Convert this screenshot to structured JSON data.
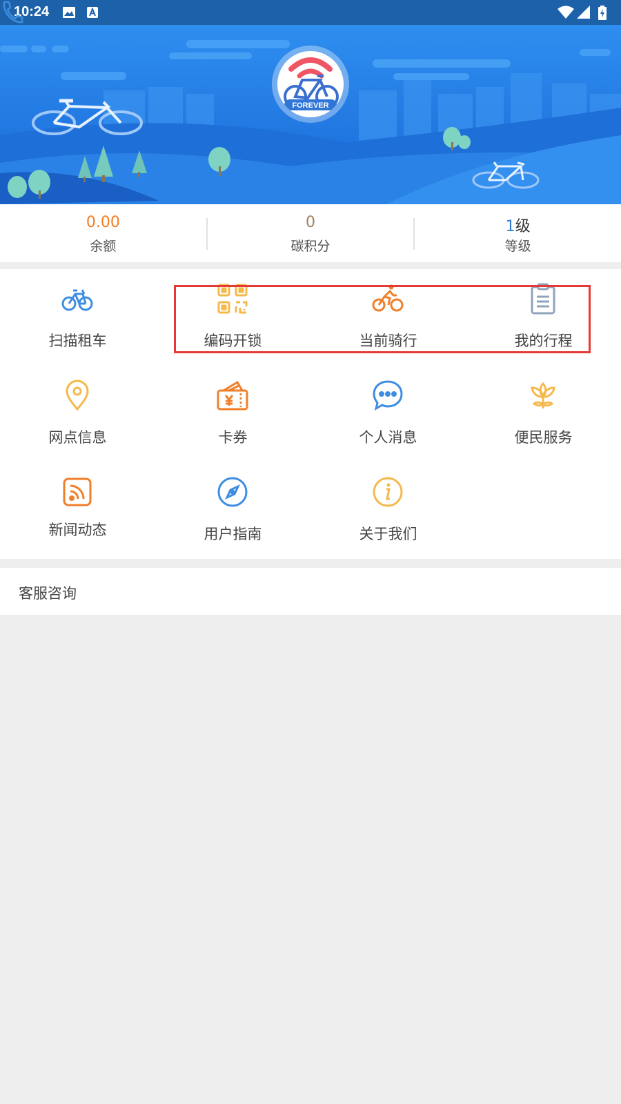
{
  "status_bar": {
    "time": "10:24"
  },
  "header": {
    "logo_text": "FOREVER"
  },
  "stats": [
    {
      "value": "0.00",
      "label": "余额",
      "color": "#f57c1f"
    },
    {
      "value": "0",
      "label": "碳积分",
      "color": "#a08060"
    },
    {
      "value": "1",
      "suffix": "级",
      "label": "等级",
      "color": "#2e7bd6"
    }
  ],
  "menu": {
    "items": [
      {
        "label": "扫描租车",
        "icon": "bike-icon"
      },
      {
        "label": "编码开锁",
        "icon": "qrcode-icon"
      },
      {
        "label": "当前骑行",
        "icon": "cyclist-icon"
      },
      {
        "label": "我的行程",
        "icon": "clipboard-icon"
      },
      {
        "label": "网点信息",
        "icon": "location-pin-icon"
      },
      {
        "label": "卡券",
        "icon": "coupon-icon"
      },
      {
        "label": "个人消息",
        "icon": "chat-bubble-icon"
      },
      {
        "label": "便民服务",
        "icon": "flower-icon"
      },
      {
        "label": "新闻动态",
        "icon": "rss-icon"
      },
      {
        "label": "用户指南",
        "icon": "compass-icon"
      },
      {
        "label": "关于我们",
        "icon": "info-icon"
      }
    ]
  },
  "service": {
    "label": "客服咨询",
    "icon": "phone-icon"
  },
  "colors": {
    "accent_blue": "#3d8de0",
    "orange": "#f07f2a",
    "yellow": "#f5b84a",
    "highlight_red": "#e53935"
  }
}
